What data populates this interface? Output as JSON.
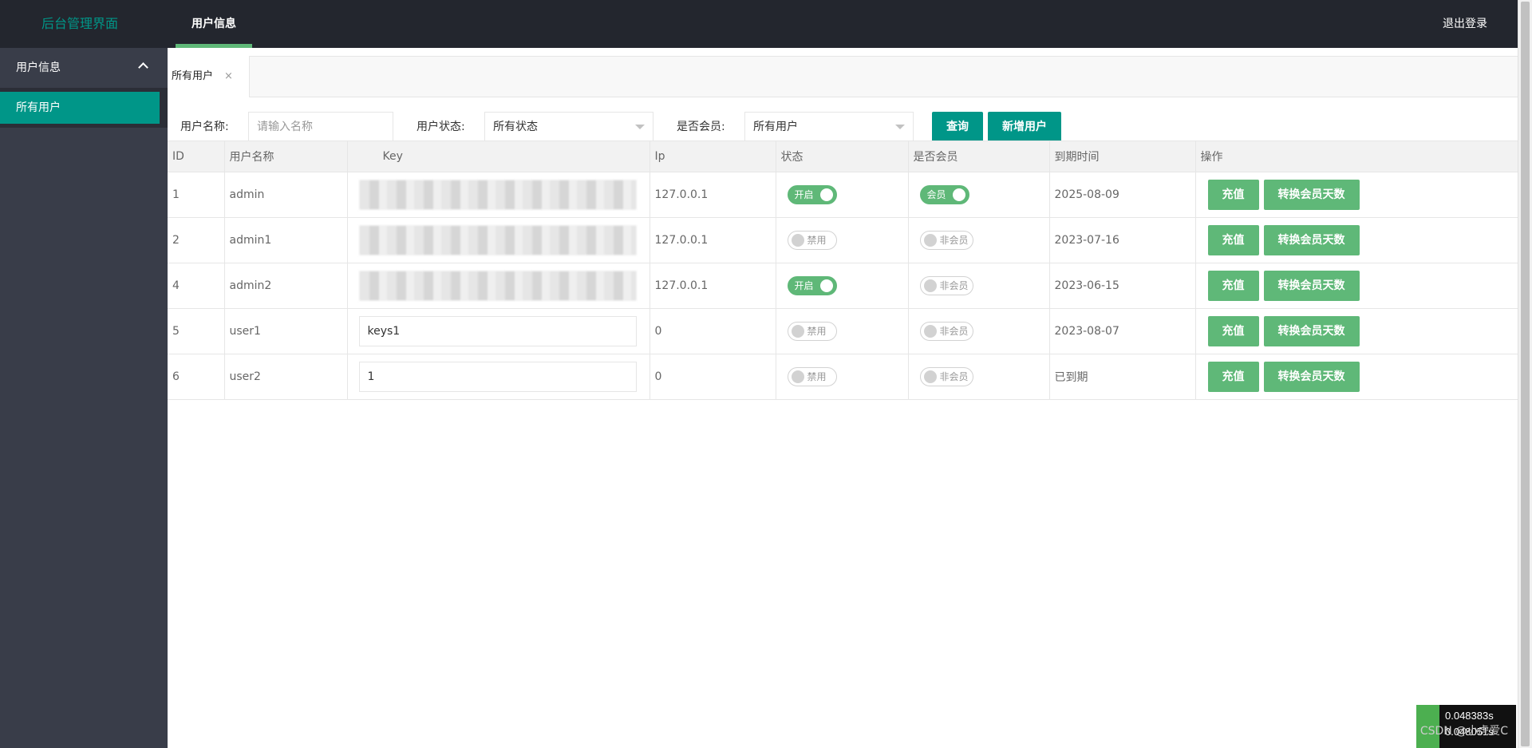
{
  "header": {
    "logo": "后台管理界面",
    "nav_item": "用户信息",
    "logout": "退出登录"
  },
  "sidebar": {
    "group_label": "用户信息",
    "items": [
      {
        "label": "所有用户"
      }
    ]
  },
  "tabs": [
    {
      "label": "所有用户",
      "close": "×"
    }
  ],
  "filters": {
    "username_label": "用户名称:",
    "username_placeholder": "请输入名称",
    "status_label": "用户状态:",
    "status_value": "所有状态",
    "member_label": "是否会员:",
    "member_value": "所有用户",
    "query_button": "查询",
    "add_button": "新增用户"
  },
  "table": {
    "headers": [
      "ID",
      "用户名称",
      "Key",
      "Ip",
      "状态",
      "是否会员",
      "到期时间",
      "操作"
    ],
    "rows": [
      {
        "id": "1",
        "name": "admin",
        "key": "",
        "key_redacted": true,
        "ip": "127.0.0.1",
        "status_on": true,
        "status": "开启",
        "member_on": true,
        "member": "会员",
        "expire": "2025-08-09"
      },
      {
        "id": "2",
        "name": "admin1",
        "key": "",
        "key_redacted": true,
        "ip": "127.0.0.1",
        "status_on": false,
        "status": "禁用",
        "member_on": false,
        "member": "非会员",
        "expire": "2023-07-16"
      },
      {
        "id": "4",
        "name": "admin2",
        "key": "",
        "key_redacted": true,
        "ip": "127.0.0.1",
        "status_on": true,
        "status": "开启",
        "member_on": false,
        "member": "非会员",
        "expire": "2023-06-15"
      },
      {
        "id": "5",
        "name": "user1",
        "key": "keys1",
        "key_redacted": false,
        "ip": "0",
        "status_on": false,
        "status": "禁用",
        "member_on": false,
        "member": "非会员",
        "expire": "2023-08-07"
      },
      {
        "id": "6",
        "name": "user2",
        "key": "1",
        "key_redacted": false,
        "ip": "0",
        "status_on": false,
        "status": "禁用",
        "member_on": false,
        "member": "非会员",
        "expire": "已到期"
      }
    ],
    "recharge_label": "充值",
    "convert_label": "转换会员天数"
  },
  "overlay": {
    "timer1": "0.048383s",
    "timer2": "0.048051s",
    "watermark": "CSDN @小虎爱C"
  },
  "colors": {
    "accent": "#009688",
    "green": "#5fb878",
    "header_bg": "#23262e",
    "sidebar_bg": "#393d49"
  }
}
